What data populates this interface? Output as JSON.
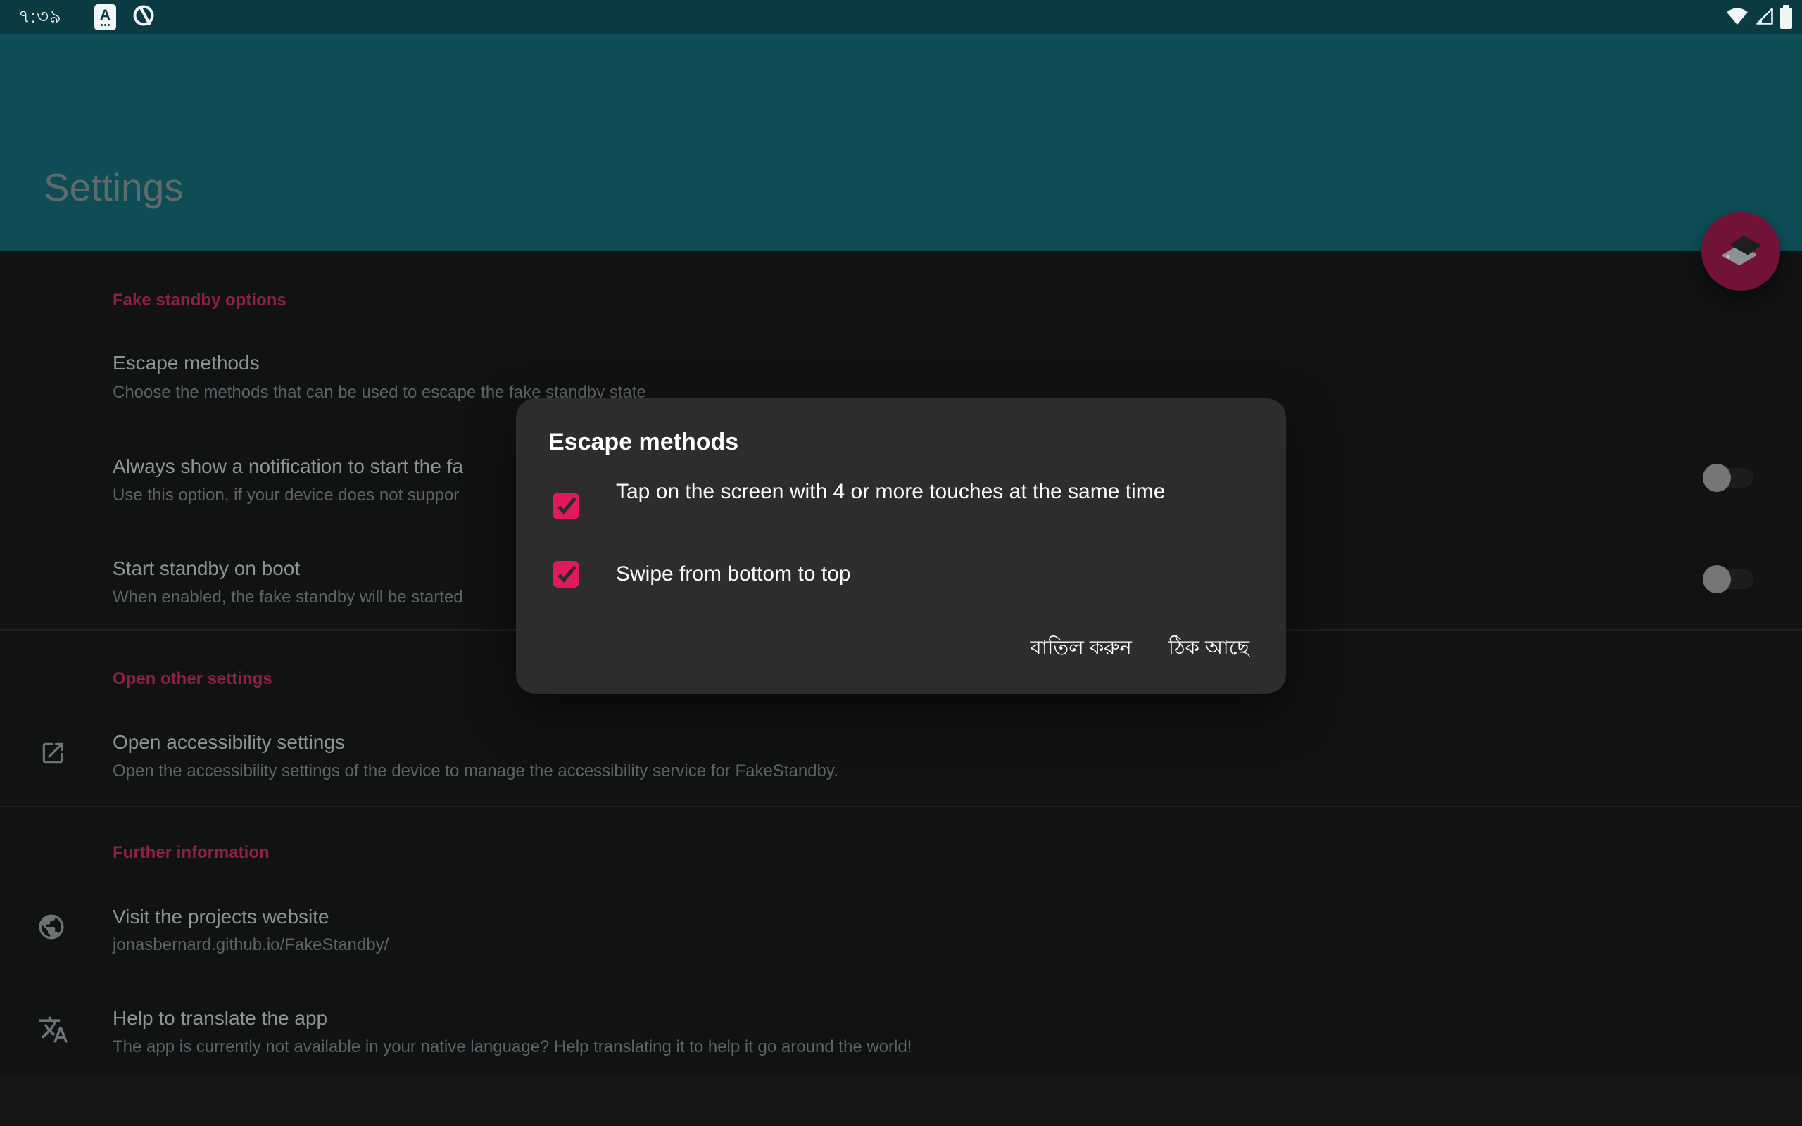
{
  "colors": {
    "accent_pink": "#e3195f",
    "header_teal": "#0e4d56",
    "status_bar_teal": "#0a3b42",
    "dialog_bg": "#2d2d2e",
    "fab_dimmed": "#701336",
    "section_label": "#8d2147"
  },
  "status_bar": {
    "time": "৭:৩৯",
    "a_icon_glyph": "A",
    "icons": [
      "autofill-a-icon",
      "data-saver-icon",
      "wifi-icon",
      "cell-signal-icon",
      "battery-icon"
    ]
  },
  "header": {
    "title": "Settings"
  },
  "fab": {
    "icon": "standby-phone-icon"
  },
  "settings_list": {
    "section1": {
      "label": "Fake standby options"
    },
    "escape_methods": {
      "title": "Escape methods",
      "subtitle": "Choose the methods that can be used to escape the fake standby state"
    },
    "notification": {
      "title": "Always show a notification to start the fa",
      "subtitle": "Use this option, if your device does not suppor",
      "toggle_on": false
    },
    "boot": {
      "title": "Start standby on boot",
      "subtitle": "When enabled, the fake standby will be started",
      "toggle_on": false
    },
    "section2": {
      "label": "Open other settings"
    },
    "accessibility": {
      "title": "Open accessibility settings",
      "subtitle": "Open the accessibility settings of the device to manage the accessibility service for FakeStandby.",
      "icon": "open-in-new-icon"
    },
    "section3": {
      "label": "Further information"
    },
    "website": {
      "title": "Visit the projects website",
      "subtitle": "jonasbernard.github.io/FakeStandby/",
      "icon": "globe-icon"
    },
    "translate": {
      "title": "Help to translate the app",
      "subtitle": "The app is currently not available in your native language? Help translating it to help it go around the world!",
      "icon": "translate-icon"
    }
  },
  "dialog": {
    "title": "Escape methods",
    "options": [
      {
        "label": "Tap on the screen with 4 or more touches at the same time",
        "checked": true
      },
      {
        "label": "Swipe from bottom to top",
        "checked": true
      }
    ],
    "cancel_label": "বাতিল করুন",
    "ok_label": "ঠিক আছে"
  },
  "nav_bar": {
    "icons": [
      "back-icon",
      "home-icon",
      "recents-icon"
    ]
  }
}
